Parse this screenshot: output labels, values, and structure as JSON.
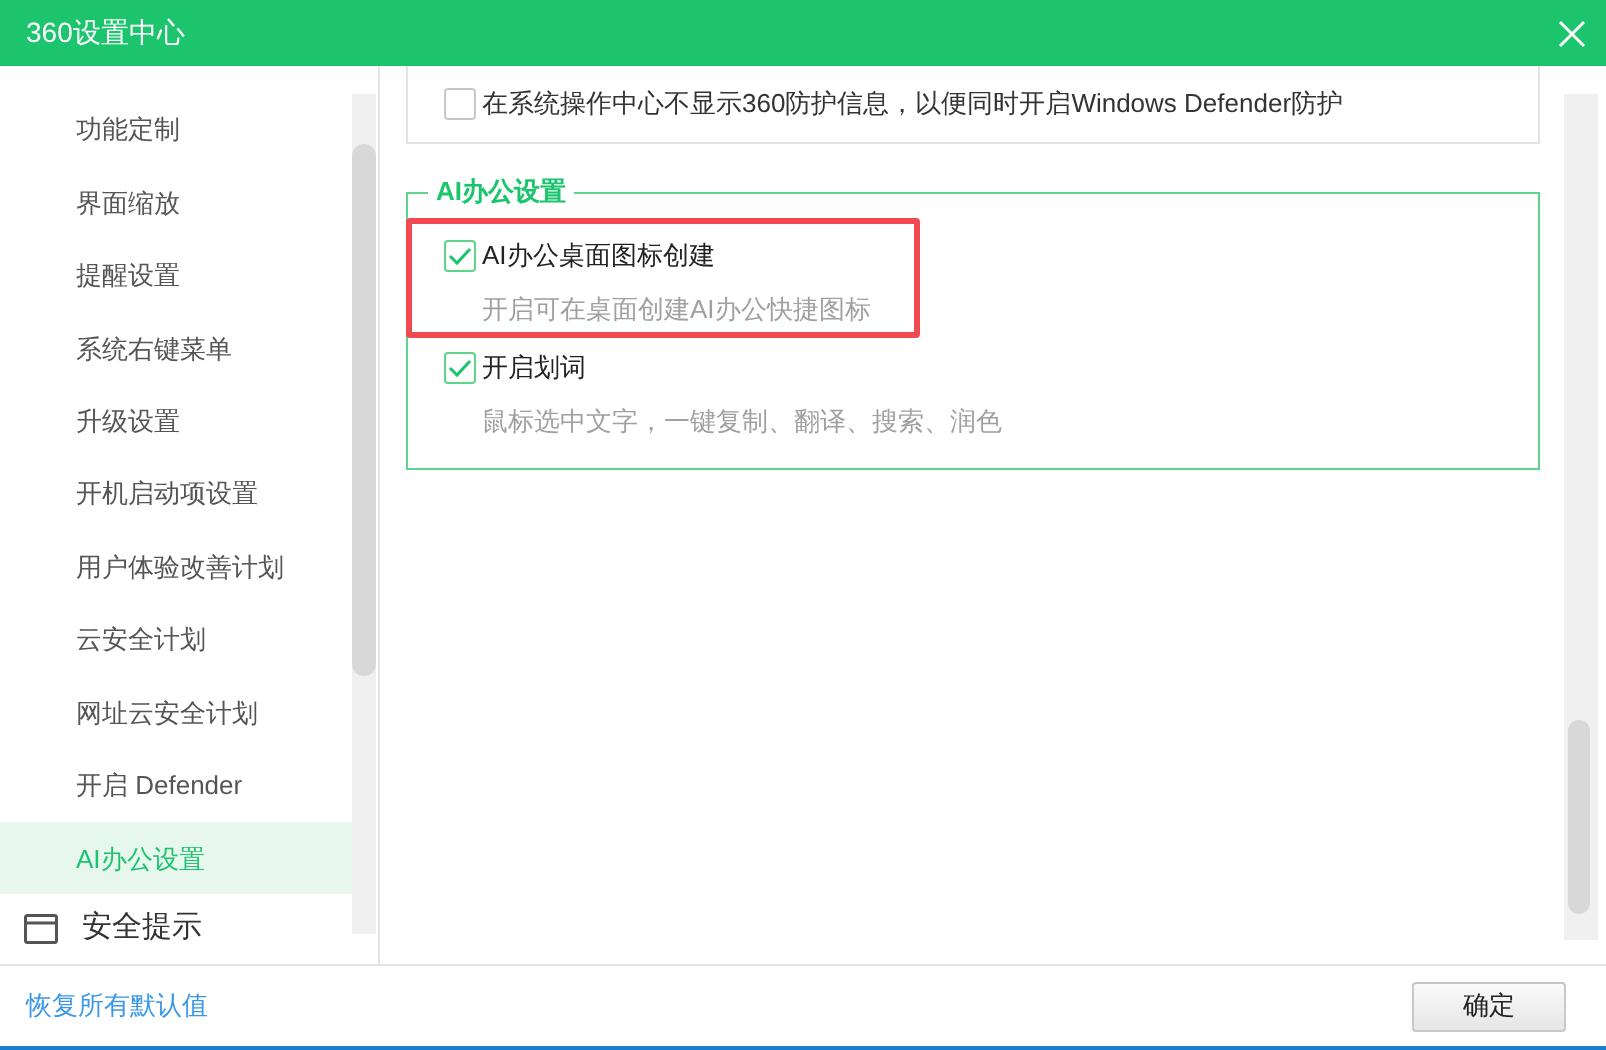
{
  "window": {
    "title": "360设置中心"
  },
  "sidebar": {
    "items": [
      {
        "label": "功能定制",
        "selected": false
      },
      {
        "label": "界面缩放",
        "selected": false
      },
      {
        "label": "提醒设置",
        "selected": false
      },
      {
        "label": "系统右键菜单",
        "selected": false
      },
      {
        "label": "升级设置",
        "selected": false
      },
      {
        "label": "开机启动项设置",
        "selected": false
      },
      {
        "label": "用户体验改善计划",
        "selected": false
      },
      {
        "label": "云安全计划",
        "selected": false
      },
      {
        "label": "网址云安全计划",
        "selected": false
      },
      {
        "label": "开启 Defender",
        "selected": false
      },
      {
        "label": "AI办公设置",
        "selected": true
      }
    ],
    "section": {
      "label": "安全提示"
    }
  },
  "top_option": {
    "label": "在系统操作中心不显示360防护信息，以便同时开启Windows Defender防护",
    "checked": false
  },
  "ai_group": {
    "title": "AI办公设置",
    "options": [
      {
        "label": "AI办公桌面图标创建",
        "description": "开启可在桌面创建AI办公快捷图标",
        "checked": true,
        "highlighted": true
      },
      {
        "label": "开启划词",
        "description": "鼠标选中文字，一键复制、翻译、搜索、润色",
        "checked": true,
        "highlighted": false
      }
    ]
  },
  "footer": {
    "reset_link": "恢复所有默认值",
    "ok_button": "确定"
  }
}
